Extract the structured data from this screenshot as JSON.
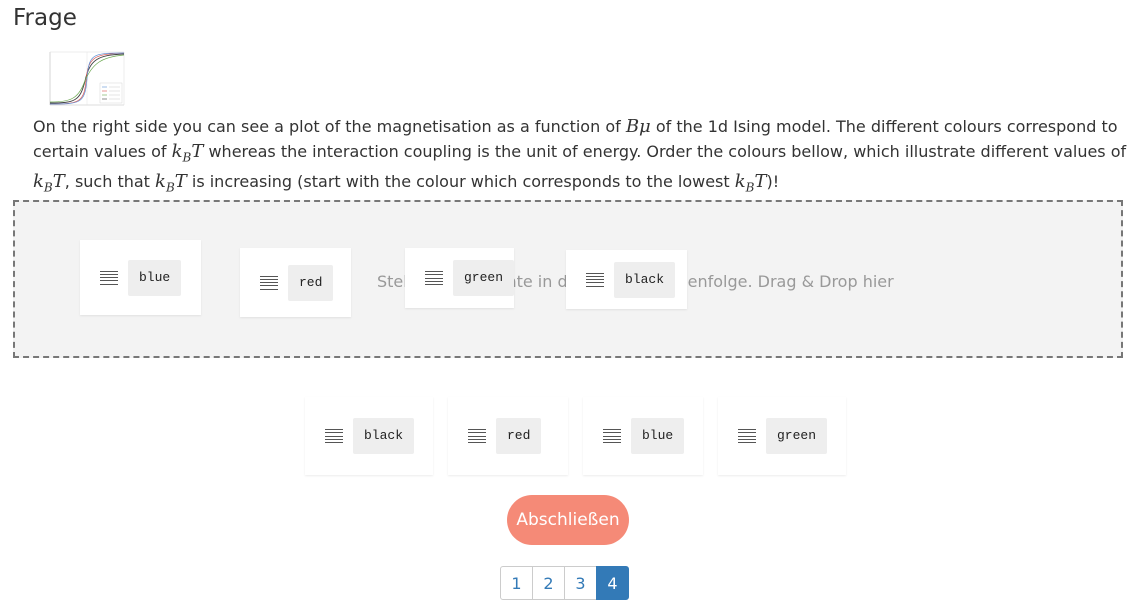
{
  "page": {
    "title": "Frage"
  },
  "question": {
    "p1": "On the right side you can see a plot of the magnetisation as a function of ",
    "m1": "Bμ",
    "p2": " of the 1d Ising model. The different colours correspond to certain values of ",
    "m2_k": "k",
    "m2_sub": "B",
    "m2_T": "T",
    "p3": " whereas the interaction coupling is the unit of energy. Order the colours bellow, which illustrate different values of ",
    "p4": ", such that ",
    "p5": " is increasing (start with the colour which corresponds to the lowest ",
    "p6": ")!"
  },
  "dropzone": {
    "placeholder": "Stelle die Elemente in die richtige Reihenfolge. Drag & Drop hier",
    "items": [
      {
        "label": "blue"
      },
      {
        "label": "red"
      },
      {
        "label": "green"
      },
      {
        "label": "black"
      }
    ]
  },
  "pool": {
    "items": [
      {
        "label": "black"
      },
      {
        "label": "red"
      },
      {
        "label": "blue"
      },
      {
        "label": "green"
      }
    ]
  },
  "finish_button": {
    "label": "Abschließen"
  },
  "pagination": {
    "pages": [
      "1",
      "2",
      "3",
      "4"
    ],
    "active": "4"
  },
  "colors": {
    "accent_button": "#f58a77",
    "pagination_active": "#337ab7",
    "dropzone_bg": "#f3f3f3",
    "chip_bg": "#eeeeee"
  }
}
